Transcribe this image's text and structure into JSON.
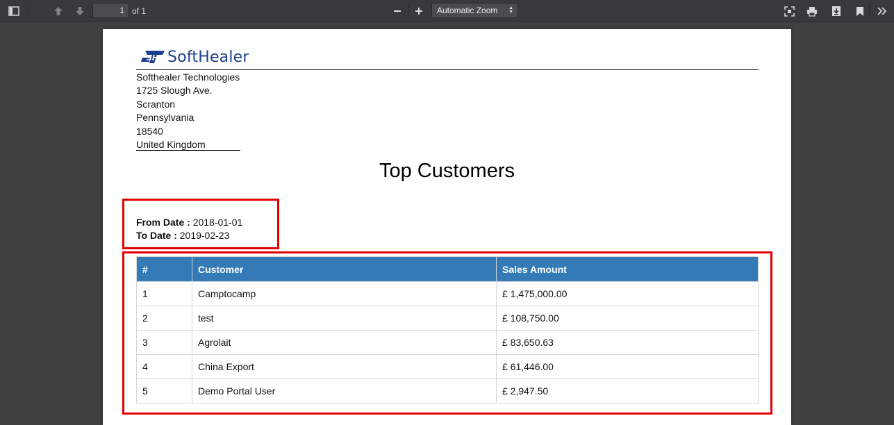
{
  "toolbar": {
    "page_number": "1",
    "page_of": "of 1",
    "zoom": "Automatic Zoom",
    "icons": [
      "sidebar-toggle-icon",
      "previous-page-icon",
      "next-page-icon",
      "zoom-out-icon",
      "zoom-in-icon",
      "presentation-mode-icon",
      "print-icon",
      "download-icon",
      "bookmark-icon",
      "tools-icon"
    ]
  },
  "company": {
    "logo_text": "SoftHealer",
    "name": "Softhealer Technologies",
    "street": "1725 Slough Ave.",
    "city": "Scranton",
    "state": "Pennsylvania",
    "zip": "18540",
    "country": "United Kingdom"
  },
  "report": {
    "title": "Top Customers",
    "from_label": "From Date :",
    "from_value": "2018-01-01",
    "to_label": "To Date :",
    "to_value": "2019-02-23"
  },
  "table": {
    "headers": [
      "#",
      "Customer",
      "Sales Amount"
    ],
    "rows": [
      [
        "1",
        "Camptocamp",
        "£ 1,475,000.00"
      ],
      [
        "2",
        "test",
        "£ 108,750.00"
      ],
      [
        "3",
        "Agrolait",
        "£ 83,650.63"
      ],
      [
        "4",
        "China Export",
        "£ 61,446.00"
      ],
      [
        "5",
        "Demo Portal User",
        "£ 2,947.50"
      ]
    ]
  },
  "colors": {
    "table_header": "#337ab7",
    "highlight": "#e00000",
    "logo": "#1b3f8f"
  }
}
